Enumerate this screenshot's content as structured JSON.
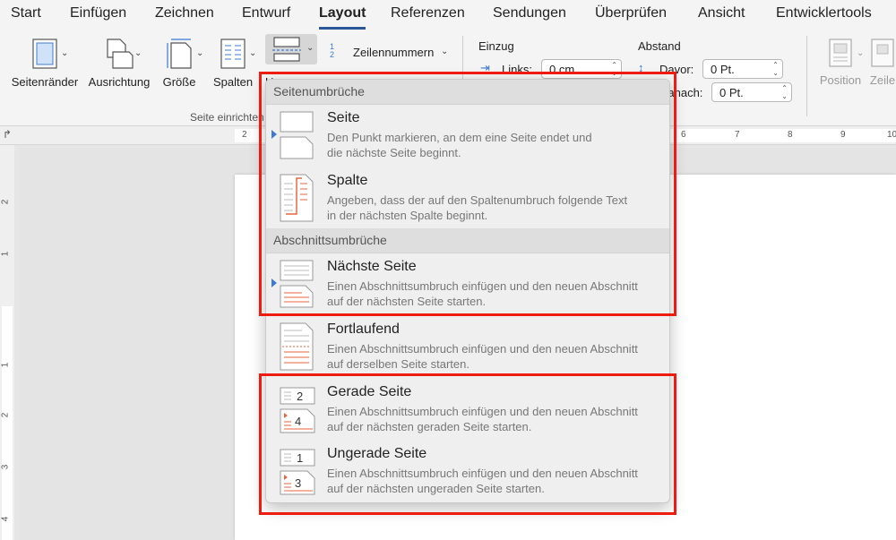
{
  "tabs": [
    "Start",
    "Einfügen",
    "Zeichnen",
    "Entwurf",
    "Layout",
    "Referenzen",
    "Sendungen",
    "Überprüfen",
    "Ansicht",
    "Entwicklertools"
  ],
  "active_tab": "Layout",
  "ribbon": {
    "margins_label": "Seitenränder",
    "orientation_label": "Ausrichtung",
    "size_label": "Größe",
    "columns_label": "Spalten",
    "breaks_label": "U",
    "line_numbers_label": "Zeilennummern",
    "line_numbers_glyph": "1 2",
    "group_label": "Seite einrichten",
    "indent_label": "Einzug",
    "indent_left_label": "Links:",
    "indent_left_value": "0 cm",
    "spacing_label": "Abstand",
    "spacing_before_label": "Davor:",
    "spacing_before_value": "0 Pt.",
    "spacing_after_label": "Danach:",
    "spacing_after_value": "0 Pt.",
    "position_label": "Position",
    "wrap_label": "Zeile"
  },
  "ruler": {
    "corner": "↱",
    "top_numbers": [
      "2",
      "6",
      "7",
      "8",
      "9",
      "10"
    ],
    "left_numbers": [
      "2",
      "1",
      "1",
      "2",
      "3",
      "4"
    ]
  },
  "menu": {
    "page_breaks_header": "Seitenumbrüche",
    "section_breaks_header": "Abschnittsumbrüche",
    "items": [
      {
        "title": "Seite",
        "desc1": "Den Punkt markieren, an dem eine Seite endet und",
        "desc2": "die nächste Seite beginnt."
      },
      {
        "title": "Spalte",
        "desc1": "Angeben, dass der auf den Spaltenumbruch folgende Text",
        "desc2": "in der nächsten Spalte beginnt."
      },
      {
        "title": "Nächste Seite",
        "desc1": "Einen Abschnittsumbruch einfügen und den neuen Abschnitt",
        "desc2": "auf der nächsten Seite starten."
      },
      {
        "title": "Fortlaufend",
        "desc1": "Einen Abschnittsumbruch einfügen und den neuen Abschnitt",
        "desc2": "auf derselben Seite starten."
      },
      {
        "title": "Gerade Seite",
        "desc1": "Einen Abschnittsumbruch einfügen und den neuen Abschnitt",
        "desc2": "auf der nächsten geraden Seite starten.",
        "num_top": "2",
        "num_bottom": "4"
      },
      {
        "title": "Ungerade Seite",
        "desc1": "Einen Abschnittsumbruch einfügen und den neuen Abschnitt",
        "desc2": "auf der nächsten ungeraden Seite starten.",
        "num_top": "1",
        "num_bottom": "3"
      }
    ]
  },
  "colors": {
    "highlight": "#ee1c10",
    "accent": "#3b7bd4",
    "break_orange": "#e8663d"
  }
}
